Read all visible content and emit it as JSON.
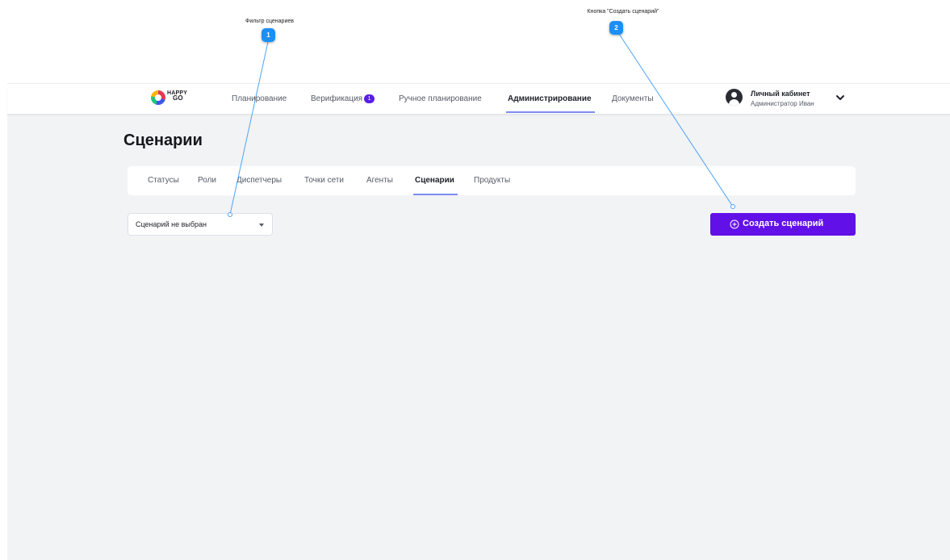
{
  "annotations": [
    {
      "number": "1",
      "label": "Фильтр сценариев"
    },
    {
      "number": "2",
      "label": "Кнопка \"Создать сценарий\""
    }
  ],
  "colors": {
    "accent": "#6210e8",
    "annotation_marker": "#1b8ff5",
    "active_underline": "#7f8cf0",
    "background": "#f2f3f5"
  },
  "header": {
    "logo": {
      "line1": "HAPPY",
      "line2": "GO"
    },
    "nav": [
      {
        "label": "Планирование"
      },
      {
        "label": "Верификация",
        "badge": "1"
      },
      {
        "label": "Ручное планирование"
      },
      {
        "label": "Администрирование",
        "active": true
      },
      {
        "label": "Документы"
      }
    ],
    "account": {
      "title": "Личный кабинет",
      "role": "Администратор Иван",
      "avatar_icon": "user-circle-icon",
      "menu_icon": "chevron-down-icon"
    }
  },
  "main": {
    "title": "Сценарии",
    "tabs": [
      {
        "label": "Статусы"
      },
      {
        "label": "Роли"
      },
      {
        "label": "Диспетчеры"
      },
      {
        "label": "Точки сети"
      },
      {
        "label": "Агенты"
      },
      {
        "label": "Сценарии",
        "active": true
      },
      {
        "label": "Продукты"
      }
    ],
    "scenario_filter": {
      "value": "Сценарий не выбран",
      "icon": "caret-down-icon"
    },
    "create_button": {
      "label": "Создать сценарий",
      "icon": "plus-circle-icon"
    }
  }
}
